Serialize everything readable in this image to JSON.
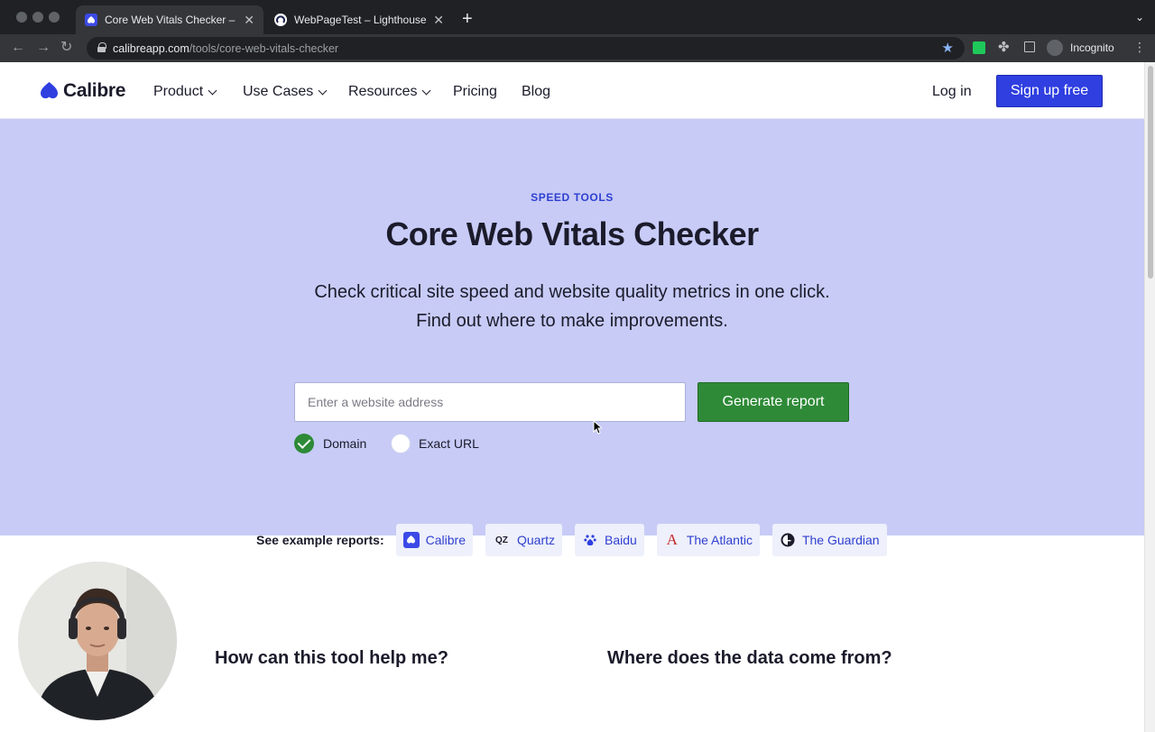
{
  "browser": {
    "tabs": [
      {
        "title": "Core Web Vitals Checker – Test",
        "active": true
      },
      {
        "title": "WebPageTest – Lighthouse Test",
        "active": false
      }
    ],
    "url_host": "calibreapp.com",
    "url_path": "/tools/core-web-vitals-checker",
    "profile_label": "Incognito"
  },
  "nav": {
    "logo": "Calibre",
    "items": [
      "Product",
      "Use Cases",
      "Resources",
      "Pricing",
      "Blog"
    ],
    "login": "Log in",
    "signup": "Sign up free"
  },
  "hero": {
    "eyebrow": "SPEED TOOLS",
    "title": "Core Web Vitals Checker",
    "lead_1": "Check critical site speed and website quality metrics in one click.",
    "lead_2": "Find out where to make improvements.",
    "input_placeholder": "Enter a website address",
    "button": "Generate report",
    "options": [
      {
        "label": "Domain",
        "selected": true
      },
      {
        "label": "Exact URL",
        "selected": false
      }
    ]
  },
  "examples": {
    "label": "See example reports:",
    "items": [
      {
        "name": "Calibre",
        "icon": "calibre-icon"
      },
      {
        "name": "Quartz",
        "icon": "quartz-icon",
        "mark": "QZ"
      },
      {
        "name": "Baidu",
        "icon": "baidu-icon"
      },
      {
        "name": "The Atlantic",
        "icon": "atlantic-icon",
        "mark": "A"
      },
      {
        "name": "The Guardian",
        "icon": "guardian-icon"
      }
    ]
  },
  "sections": {
    "left_heading": "How can this tool help me?",
    "right_heading": "Where does the data come from?"
  },
  "colors": {
    "brand_blue": "#2f3fe0",
    "hero_bg": "#c7cbf6",
    "cta_green": "#2e8a37"
  }
}
